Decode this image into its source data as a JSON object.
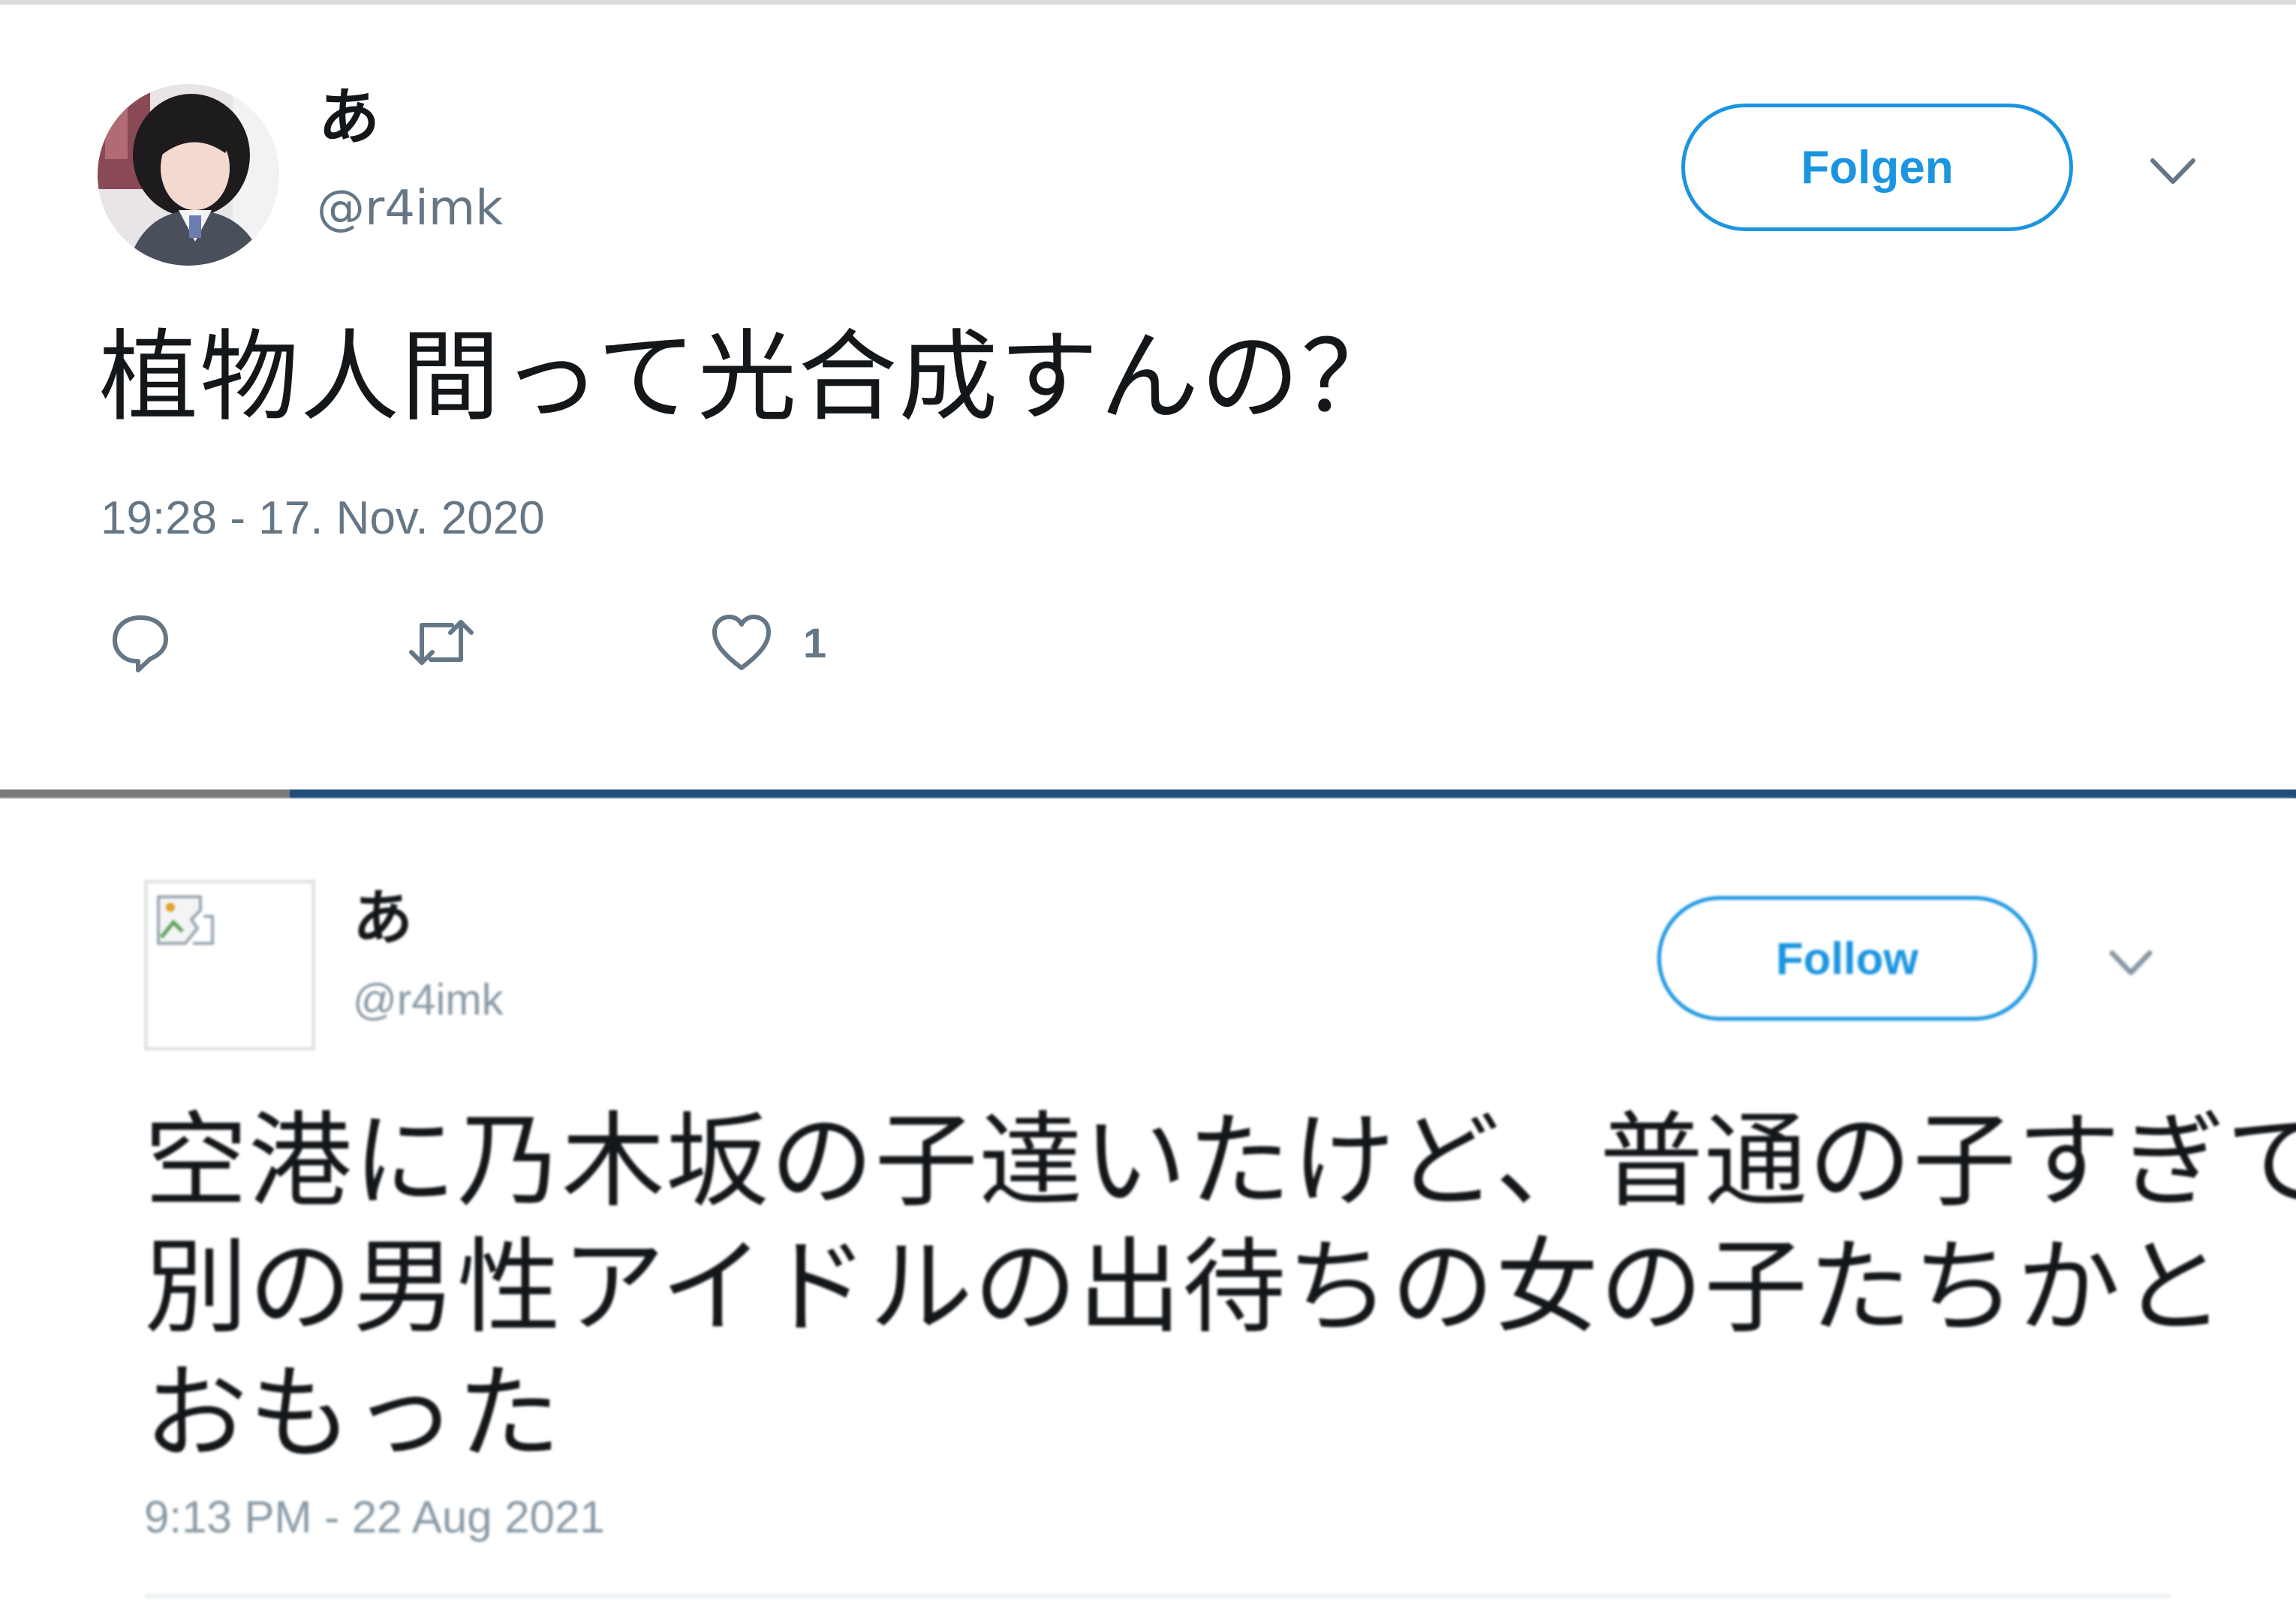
{
  "tweet1": {
    "display_name": "あ",
    "handle": "@r4imk",
    "follow_label": "Folgen",
    "text": "植物人間って光合成すんの？",
    "timestamp": "19:28 - 17. Nov. 2020",
    "like_count": "1",
    "icons": {
      "reply": "reply-icon",
      "retweet": "retweet-icon",
      "like": "heart-icon",
      "menu": "chevron-down-icon"
    }
  },
  "tweet2": {
    "display_name": "あ",
    "handle": "@r4imk",
    "follow_label": "Follow",
    "text_lines": [
      "空港に乃木坂の子達いたけど、普通の子すぎて",
      "別の男性アイドルの出待ちの女の子たちかと",
      "おもった"
    ],
    "timestamp": "9:13 PM - 22 Aug 2021",
    "icons": {
      "avatar": "broken-image-icon",
      "menu": "chevron-down-icon"
    }
  },
  "colors": {
    "accent": "#1b95e0",
    "secondary_text": "#657786",
    "divider_blue": "#1f4e79",
    "divider_gray": "#7a7a7a"
  }
}
